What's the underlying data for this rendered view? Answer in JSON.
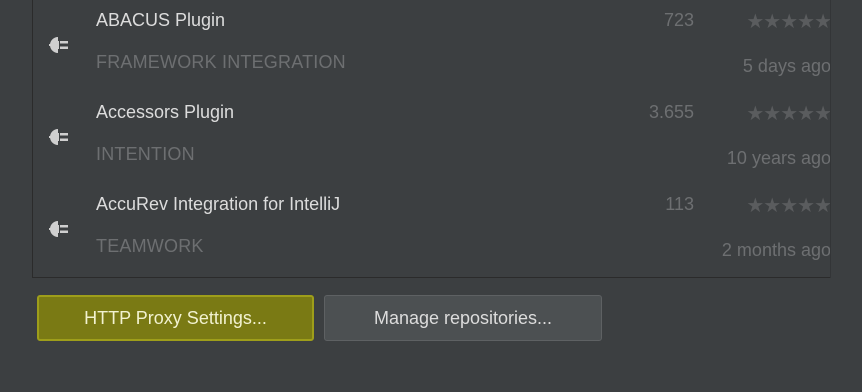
{
  "plugins": [
    {
      "name": "ABACUS Plugin",
      "category": "FRAMEWORK INTEGRATION",
      "downloads": "723",
      "rating_stars": "★★★★★",
      "date": "5 days ago",
      "icon": "plugin-icon"
    },
    {
      "name": "Accessors Plugin",
      "category": "INTENTION",
      "downloads": "3.655",
      "rating_stars": "★★★★★",
      "date": "10 years ago",
      "icon": "plugin-icon"
    },
    {
      "name": "AccuRev Integration for IntelliJ",
      "category": "TEAMWORK",
      "downloads": "113",
      "rating_stars": "★★★★★",
      "date": "2 months ago",
      "icon": "plugin-icon"
    }
  ],
  "buttons": {
    "proxy_label": "HTTP Proxy Settings...",
    "repos_label": "Manage repositories..."
  },
  "colors": {
    "background": "#3c3f41",
    "highlight": "#7a7a14",
    "text": "#dcdcdc",
    "muted": "#6d6f71"
  }
}
